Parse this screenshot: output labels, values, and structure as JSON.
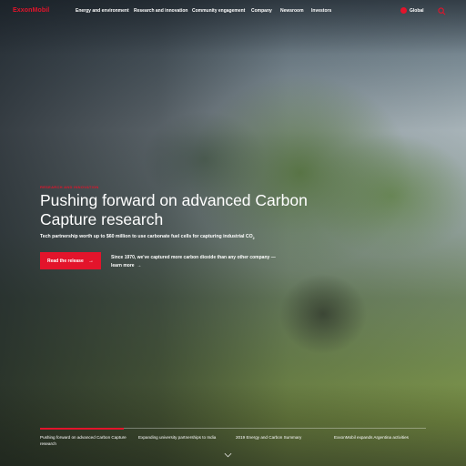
{
  "brand": {
    "logo": "ExxonMobil",
    "accent": "#e3142b"
  },
  "nav": {
    "items": [
      "Energy and environment",
      "Research and innovation",
      "Community engagement",
      "Company",
      "Newsroom",
      "Investors"
    ],
    "global_label": "Global",
    "icons": {
      "globe": "globe-icon",
      "search": "search-icon"
    }
  },
  "hero": {
    "eyebrow": "RESEARCH AND INNOVATION",
    "headline": "Pushing forward on advanced Carbon Capture research",
    "subhead_main": "Tech partnership worth up to $60 million to use carbonate fuel cells for capturing industrial CO",
    "subhead_sub": "2",
    "cta_label": "Read the release",
    "cta_arrow": "→",
    "since_text": "Since 1970, we've captured more carbon dioxide than any other company —",
    "learn_more": "learn more",
    "learn_arrow": "→"
  },
  "carousel": {
    "active_index": 0,
    "items": [
      "Pushing forward on advanced Carbon Capture research",
      "Expanding university partnerships to India",
      "2019 Energy and Carbon Summary",
      "ExxonMobil expands Argentina activities"
    ]
  }
}
